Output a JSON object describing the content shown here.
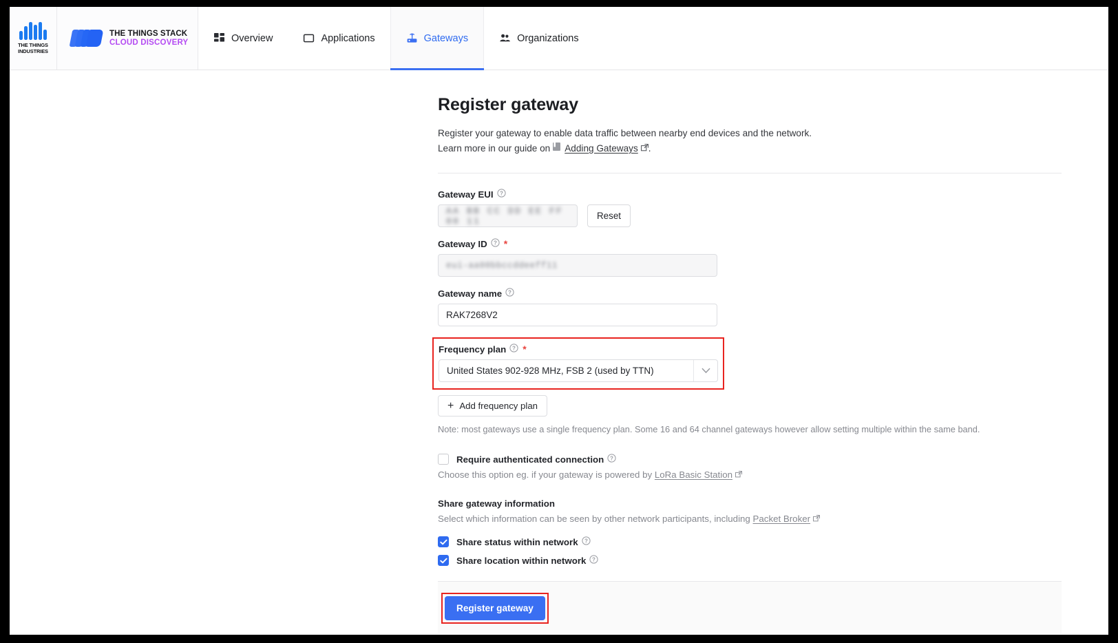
{
  "brand": {
    "tti_line1": "THE THINGS",
    "tti_line2": "INDUSTRIES",
    "stack_line1": "THE THINGS STACK",
    "stack_line2": "CLOUD DISCOVERY",
    "accent_blue": "#2667f5",
    "accent_purple": "#b44bf2"
  },
  "nav": {
    "tabs": [
      {
        "label": "Overview",
        "icon": "grid-icon",
        "active": false
      },
      {
        "label": "Applications",
        "icon": "application-icon",
        "active": false
      },
      {
        "label": "Gateways",
        "icon": "gateway-icon",
        "active": true
      },
      {
        "label": "Organizations",
        "icon": "organizations-icon",
        "active": false
      }
    ],
    "active_color": "#2f6bf0"
  },
  "page": {
    "title": "Register gateway",
    "description": "Register your gateway to enable data traffic between nearby end devices and the network.",
    "guide_prefix": "Learn more in our guide on",
    "guide_link": "Adding Gateways",
    "guide_suffix": "."
  },
  "form": {
    "gateway_eui": {
      "label": "Gateway EUI",
      "value_redacted": "AA BB CC DD EE FF 00 11",
      "reset_label": "Reset",
      "required": false
    },
    "gateway_id": {
      "label": "Gateway ID",
      "value_redacted": "eui-aa00bbccddeeff11",
      "required": true
    },
    "gateway_name": {
      "label": "Gateway name",
      "value": "RAK7268V2",
      "required": false
    },
    "frequency_plan": {
      "label": "Frequency plan",
      "value": "United States 902-928 MHz, FSB 2 (used by TTN)",
      "required": true,
      "highlighted": true,
      "highlight_color": "#e8231f",
      "add_label": "Add frequency plan",
      "note": "Note: most gateways use a single frequency plan. Some 16 and 64 channel gateways however allow setting multiple within the same band."
    },
    "require_auth": {
      "label": "Require authenticated connection",
      "checked": false,
      "help_prefix": "Choose this option eg. if your gateway is powered by",
      "help_link": "LoRa Basic Station"
    },
    "share_section": {
      "title": "Share gateway information",
      "description_prefix": "Select which information can be seen by other network participants, including",
      "description_link": "Packet Broker",
      "options": [
        {
          "label": "Share status within network",
          "checked": true
        },
        {
          "label": "Share location within network",
          "checked": true
        }
      ]
    },
    "submit": {
      "label": "Register gateway",
      "color": "#3a6ff2",
      "highlighted": true,
      "highlight_color": "#e8231f"
    }
  }
}
